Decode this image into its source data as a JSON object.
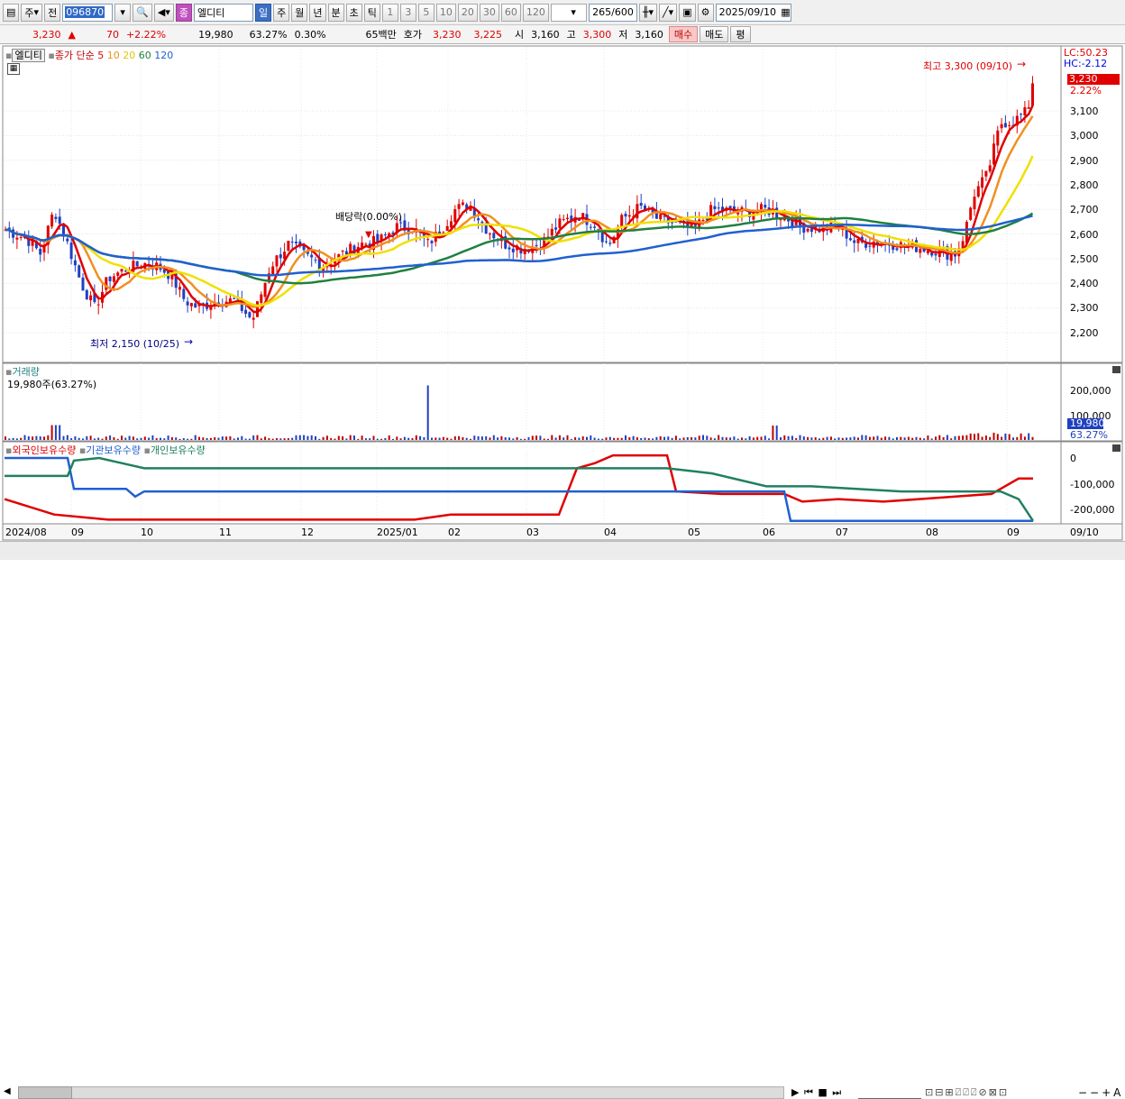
{
  "toolbar": {
    "period_type": "주",
    "prev_label": "전",
    "code": "096870",
    "market_badge": "종",
    "stock_name": "엘디티",
    "timeframes": [
      "일",
      "주",
      "월",
      "년",
      "분",
      "초",
      "틱"
    ],
    "minutes": [
      "1",
      "3",
      "5",
      "10",
      "20",
      "30",
      "60",
      "120"
    ],
    "count": "265",
    "count_max": "/600",
    "date": "2025/09/10"
  },
  "quote": {
    "price": "3,230",
    "arrow": "▲",
    "change": "70",
    "change_pct": "+2.22%",
    "volume": "19,980",
    "volume_pct": "63.27%",
    "turnover_pct": "0.30%",
    "trade_value": "65백만",
    "ask_label": "호가",
    "ask": "3,230",
    "bid": "3,225",
    "open_label": "시",
    "open": "3,160",
    "high_label": "고",
    "high": "3,300",
    "low_label": "저",
    "low": "3,160",
    "buy_label": "매수",
    "sell_label": "매도",
    "eval_label": "평"
  },
  "price_panel": {
    "name": "엘디티",
    "ma_label": "종가 단순",
    "ma_periods": [
      "5",
      "10",
      "20",
      "60",
      "120"
    ],
    "ma_colors": [
      "#e00000",
      "#f09020",
      "#f0e000",
      "#208040",
      "#2060d0"
    ],
    "lc": "LC:50.23",
    "hc": "HC:-2.12",
    "last_price": "3,230",
    "last_pct": "2.22%",
    "high_note": "최고 3,300 (09/10)",
    "low_note": "최저 2,150 (10/25)",
    "dividend_note": "배당락(0.00%)",
    "y_ticks": [
      "3,100",
      "3,000",
      "2,900",
      "2,800",
      "2,700",
      "2,600",
      "2,500",
      "2,400",
      "2,300",
      "2,200"
    ]
  },
  "volume_panel": {
    "title": "거래량",
    "value_note": "19,980주(63.27%)",
    "y_ticks": [
      "200,000",
      "100,000"
    ],
    "last_value": "19,980",
    "last_pct": "63.27%"
  },
  "holding_panel": {
    "series": [
      {
        "name": "외국인보유수량",
        "color": "#e00000"
      },
      {
        "name": "기관보유수량",
        "color": "#2060d0"
      },
      {
        "name": "개인보유수량",
        "color": "#208060"
      }
    ],
    "y_ticks": [
      "0",
      "-100,000",
      "-200,000"
    ]
  },
  "x_axis": [
    "2024/08",
    "09",
    "10",
    "11",
    "12",
    "2025/01",
    "02",
    "03",
    "04",
    "05",
    "06",
    "07",
    "08",
    "09",
    "09/10"
  ]
}
